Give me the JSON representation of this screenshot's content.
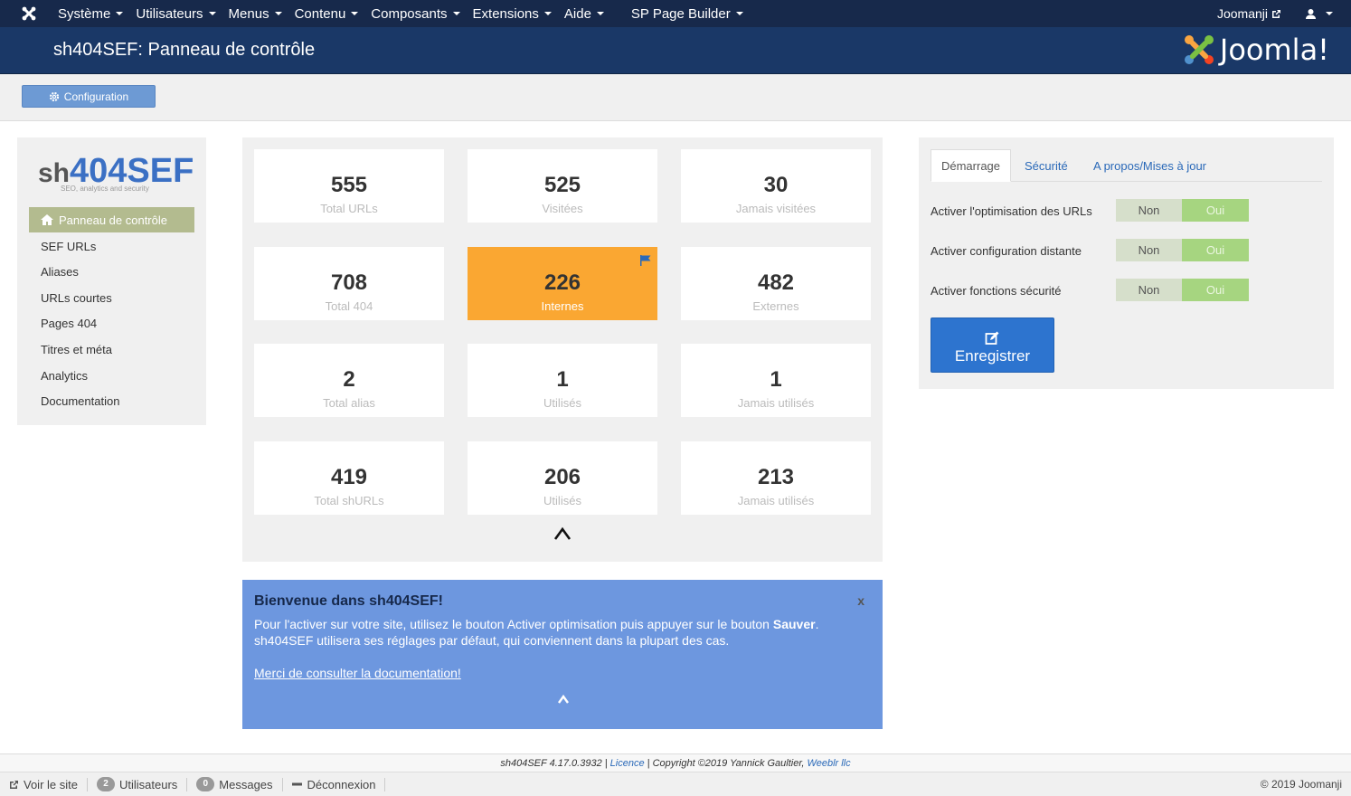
{
  "navbar": {
    "menus": [
      "Système",
      "Utilisateurs",
      "Menus",
      "Contenu",
      "Composants",
      "Extensions",
      "Aide",
      "SP Page Builder"
    ],
    "site_link": "Joomanji"
  },
  "header": {
    "title": "sh404SEF: Panneau de contrôle",
    "brand": "Joomla!"
  },
  "toolbar": {
    "config_label": "Configuration"
  },
  "sidebar": {
    "logo_prefix": "sh",
    "logo_main": "404SEF",
    "logo_tagline": "SEO, analytics and security",
    "active": "Panneau de contrôle",
    "items": [
      "SEF URLs",
      "Aliases",
      "URLs courtes",
      "Pages 404",
      "Titres et méta",
      "Analytics",
      "Documentation"
    ]
  },
  "stats": [
    {
      "value": "555",
      "label": "Total URLs"
    },
    {
      "value": "525",
      "label": "Visitées"
    },
    {
      "value": "30",
      "label": "Jamais visitées"
    },
    {
      "value": "708",
      "label": "Total 404"
    },
    {
      "value": "226",
      "label": "Internes"
    },
    {
      "value": "482",
      "label": "Externes"
    },
    {
      "value": "2",
      "label": "Total alias"
    },
    {
      "value": "1",
      "label": "Utilisés"
    },
    {
      "value": "1",
      "label": "Jamais utilisés"
    },
    {
      "value": "419",
      "label": "Total shURLs"
    },
    {
      "value": "206",
      "label": "Utilisés"
    },
    {
      "value": "213",
      "label": "Jamais utilisés"
    }
  ],
  "welcome": {
    "title": "Bienvenue dans sh404SEF!",
    "close": "x",
    "text_before": "Pour l'activer sur votre site, utilisez le bouton Activer optimisation puis appuyer sur le bouton ",
    "text_bold": "Sauver",
    "text_after": ".",
    "text_line2": "sh404SEF utilisera ses réglages par défaut, qui conviennent dans la plupart des cas.",
    "link": "Merci de consulter la documentation!"
  },
  "panel": {
    "tabs": [
      "Démarrage",
      "Sécurité",
      "A propos/Mises à jour"
    ],
    "options": [
      {
        "label": "Activer l'optimisation des URLs",
        "off": "Non",
        "on": "Oui"
      },
      {
        "label": "Activer configuration distante",
        "off": "Non",
        "on": "Oui"
      },
      {
        "label": "Activer fonctions sécurité",
        "off": "Non",
        "on": "Oui"
      }
    ],
    "save_label": "Enregistrer"
  },
  "footer": {
    "version": "sh404SEF 4.17.0.3932 | ",
    "licence": "Licence",
    "copyright": " | Copyright ©2019 Yannick Gaultier, ",
    "company": "Weeblr llc"
  },
  "statusbar": {
    "view_site": "Voir le site",
    "users_count": "2",
    "users_label": "Utilisateurs",
    "messages_count": "0",
    "messages_label": "Messages",
    "logout": "Déconnexion",
    "right": "© 2019 Joomanji"
  },
  "colors": {
    "navbar": "#17294b",
    "header": "#1a3867",
    "highlight": "#faa732",
    "welcome": "#6d97df",
    "save_button": "#2d74cf"
  }
}
